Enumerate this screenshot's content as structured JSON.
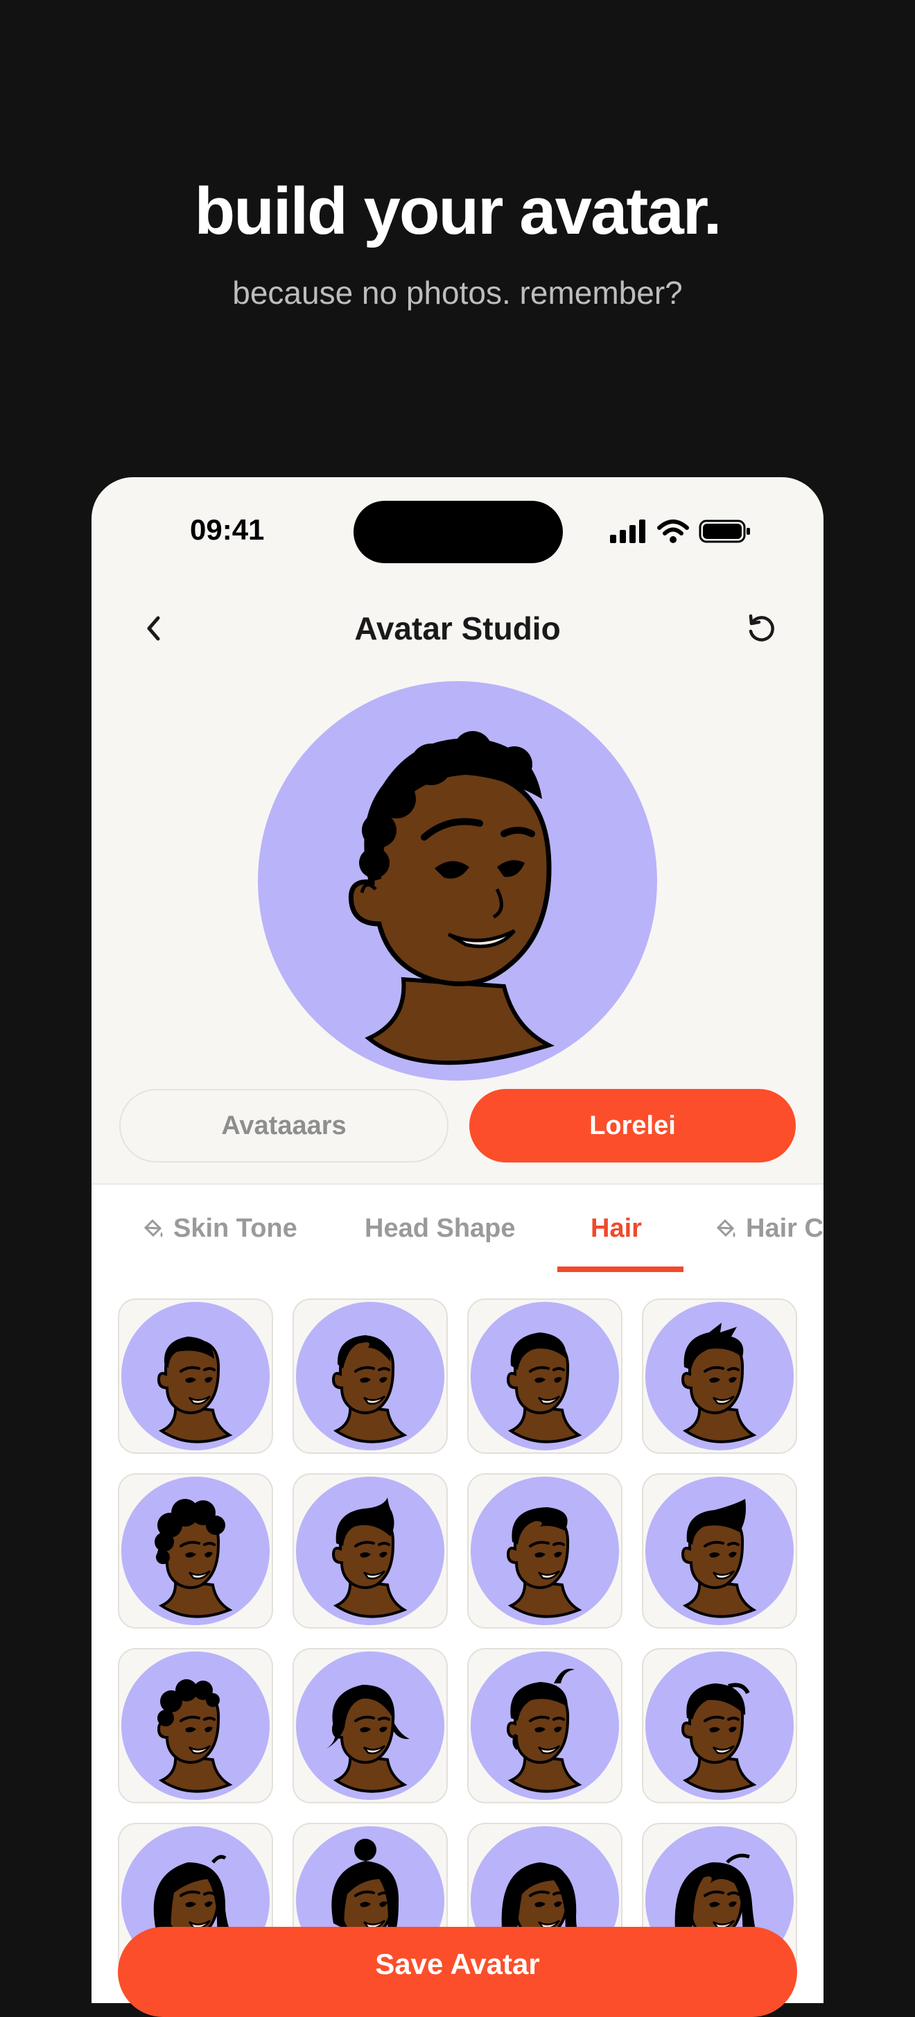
{
  "hero": {
    "title": "build your avatar.",
    "subtitle": "because no photos. remember?"
  },
  "status_bar": {
    "time": "09:41",
    "icons": [
      "signal-icon",
      "wifi-icon",
      "battery-icon"
    ]
  },
  "nav": {
    "title": "Avatar Studio",
    "back_icon": "chevron-left-icon",
    "reset_icon": "reset-icon"
  },
  "style_toggle": {
    "options": [
      "Avataaars",
      "Lorelei"
    ],
    "selected": "Lorelei"
  },
  "tabs": {
    "items": [
      "Skin Tone",
      "Head Shape",
      "Hair",
      "Hair C"
    ],
    "selected": "Hair"
  },
  "colors": {
    "accent": "#fc4e2a",
    "avatar_background": "#b9b3f9",
    "skin": "#6b3b14",
    "app_background": "#f7f6f3",
    "page_background": "#121212"
  },
  "hair_options": {
    "count_visible": 16,
    "styles": [
      "short-1",
      "short-2",
      "short-3",
      "spiky",
      "curly",
      "short-fringe",
      "swept",
      "quiff",
      "curly-short",
      "bob",
      "wavy-curl",
      "side-swept",
      "long-1",
      "bun",
      "long-2",
      "long-3"
    ]
  },
  "save_button": {
    "label": "Save Avatar"
  }
}
